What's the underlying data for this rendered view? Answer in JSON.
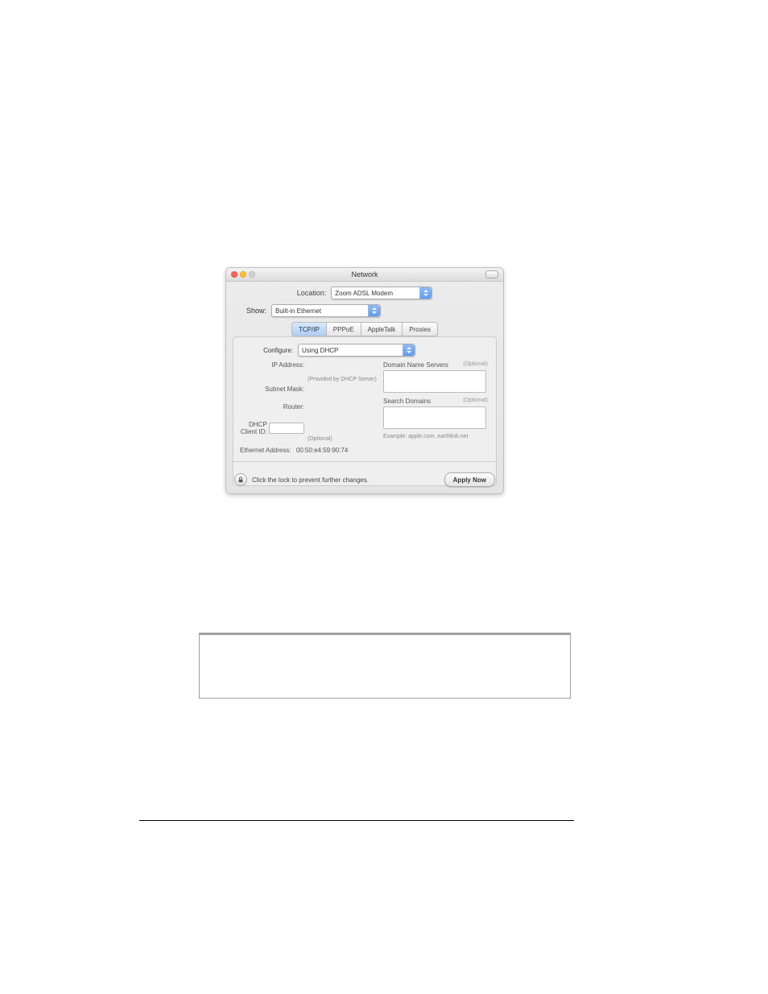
{
  "panel": {
    "title": "Network",
    "traffic_colors": [
      "#ff5f57",
      "#febc2e",
      "#d0d0d0"
    ],
    "location_label": "Location:",
    "location_value": "Zoom ADSL Modem",
    "show_label": "Show:",
    "show_value": "Built-in Ethernet",
    "tabs": [
      "TCP/IP",
      "PPPoE",
      "AppleTalk",
      "Proxies"
    ],
    "active_tab": 0,
    "configure_label": "Configure:",
    "configure_value": "Using DHCP",
    "left_labels": {
      "ip": "IP Address:",
      "ip_hint": "(Provided by DHCP Server)",
      "subnet": "Subnet Mask:",
      "router": "Router:",
      "dhcp": "DHCP Client ID:",
      "dhcp_hint": "(Optional)",
      "eth": "Ethernet Address:",
      "eth_val": "00:50:e4:59:90:74"
    },
    "right_labels": {
      "dns": "Domain Name Servers",
      "dns_opt": "(Optional)",
      "sd": "Search Domains",
      "sd_opt": "(Optional)",
      "example": "Example: apple.com, earthlink.net"
    },
    "lock_text": "Click the lock to prevent further changes.",
    "apply_label": "Apply Now"
  }
}
